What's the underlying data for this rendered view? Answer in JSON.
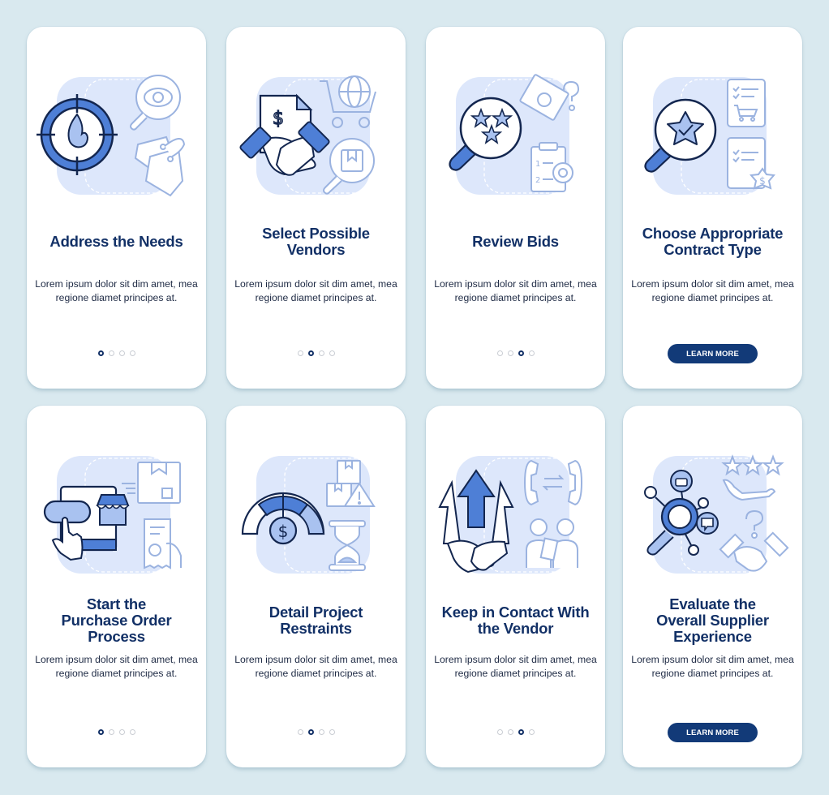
{
  "colors": {
    "background": "#d9e9ef",
    "card": "#ffffff",
    "title_text": "#123066",
    "body_text": "#1e2a44",
    "accent": "#4e7fd6",
    "accent_light": "#b6cbf3",
    "illustration_bg": "#dde7fb",
    "button_bg": "#123a78",
    "dot_inactive": "#c9cdd3"
  },
  "screens": [
    {
      "title": "Address the Needs",
      "description": "Lorem ipsum dolor sit dim amet, mea regione diamet principes at.",
      "illustration": [
        "target-fire-icon",
        "magnifier-eye-icon",
        "price-tags-icon"
      ],
      "footer": "dots",
      "active_dot": 1,
      "dot_count": 4
    },
    {
      "title": "Select Possible Vendors",
      "description": "Lorem ipsum dolor sit dim amet, mea regione diamet principes at.",
      "illustration": [
        "contract-handshake-icon",
        "global-cart-icon",
        "magnifier-box-icon"
      ],
      "footer": "dots",
      "active_dot": 2,
      "dot_count": 4
    },
    {
      "title": "Review Bids",
      "description": "Lorem ipsum dolor sit dim amet, mea regione diamet principes at.",
      "illustration": [
        "magnifier-stars-icon",
        "money-question-icon",
        "clipboard-target-icon"
      ],
      "footer": "dots",
      "active_dot": 3,
      "dot_count": 4
    },
    {
      "title": "Choose Appropriate Contract Type",
      "description": "Lorem ipsum dolor sit dim amet, mea regione diamet principes at.",
      "illustration": [
        "magnifier-star-check-icon",
        "checklist-cart-icon",
        "checklist-dollar-icon"
      ],
      "footer": "button",
      "button_label": "LEARN MORE"
    },
    {
      "title": "Start the Purchase Order Process",
      "description": "Lorem ipsum dolor sit dim amet, mea regione diamet principes at.",
      "illustration": [
        "tablet-store-tap-icon",
        "package-delivery-icon",
        "receipt-hand-icon"
      ],
      "footer": "dots",
      "active_dot": 1,
      "dot_count": 4
    },
    {
      "title": "Detail Project Restraints",
      "description": "Lorem ipsum dolor sit dim amet, mea regione diamet principes at.",
      "illustration": [
        "budget-gauge-icon",
        "boxes-warning-icon",
        "hourglass-icon"
      ],
      "footer": "dots",
      "active_dot": 2,
      "dot_count": 4
    },
    {
      "title": "Keep in Contact With the Vendor",
      "description": "Lorem ipsum dolor sit dim amet, mea regione diamet principes at.",
      "illustration": [
        "handshake-arrows-icon",
        "phone-exchange-icon",
        "people-tablet-icon"
      ],
      "footer": "dots",
      "active_dot": 3,
      "dot_count": 4
    },
    {
      "title": "Evaluate the Overall Supplier Experience",
      "description": "Lorem ipsum dolor sit dim amet, mea regione diamet principes at.",
      "illustration": [
        "magnifier-network-icon",
        "rating-hand-icon",
        "handshake-question-icon"
      ],
      "footer": "button",
      "button_label": "LEARN MORE"
    }
  ]
}
